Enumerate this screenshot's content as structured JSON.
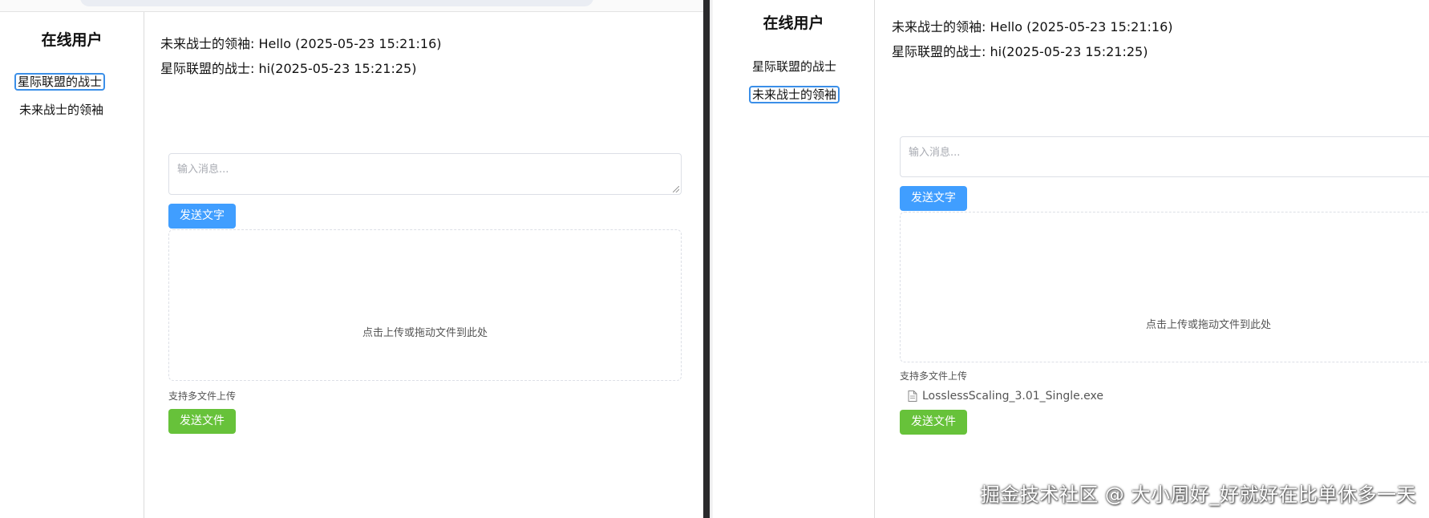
{
  "left": {
    "sidebar": {
      "title": "在线用户",
      "users": [
        {
          "label": "星际联盟的战士"
        },
        {
          "label": "未来战士的领袖"
        }
      ]
    },
    "chat": {
      "messages": [
        {
          "text": "未来战士的领袖: Hello (2025-05-23 15:21:16)"
        },
        {
          "text": "星际联盟的战士: hi(2025-05-23 15:21:25)"
        }
      ],
      "input_placeholder": "输入消息...",
      "send_text_label": "发送文字",
      "upload_hint": "点击上传或拖动文件到此处",
      "upload_tip": "支持多文件上传",
      "send_file_label": "发送文件"
    }
  },
  "right": {
    "sidebar": {
      "title": "在线用户",
      "users": [
        {
          "label": "星际联盟的战士"
        },
        {
          "label": "未来战士的领袖"
        }
      ]
    },
    "chat": {
      "messages": [
        {
          "text": "未来战士的领袖: Hello (2025-05-23 15:21:16)"
        },
        {
          "text": "星际联盟的战士: hi(2025-05-23 15:21:25)"
        }
      ],
      "input_placeholder": "输入消息...",
      "send_text_label": "发送文字",
      "upload_hint": "点击上传或拖动文件到此处",
      "upload_tip": "支持多文件上传",
      "files": [
        {
          "name": "LosslessScaling_3.01_Single.exe",
          "icon": "document-icon"
        }
      ],
      "send_file_label": "发送文件"
    }
  },
  "watermark": "掘金技术社区 @ 大小周好_好就好在比单休多一天",
  "colors": {
    "primary": "#409eff",
    "success": "#67c23a",
    "active_outline": "#3b8fe8"
  }
}
